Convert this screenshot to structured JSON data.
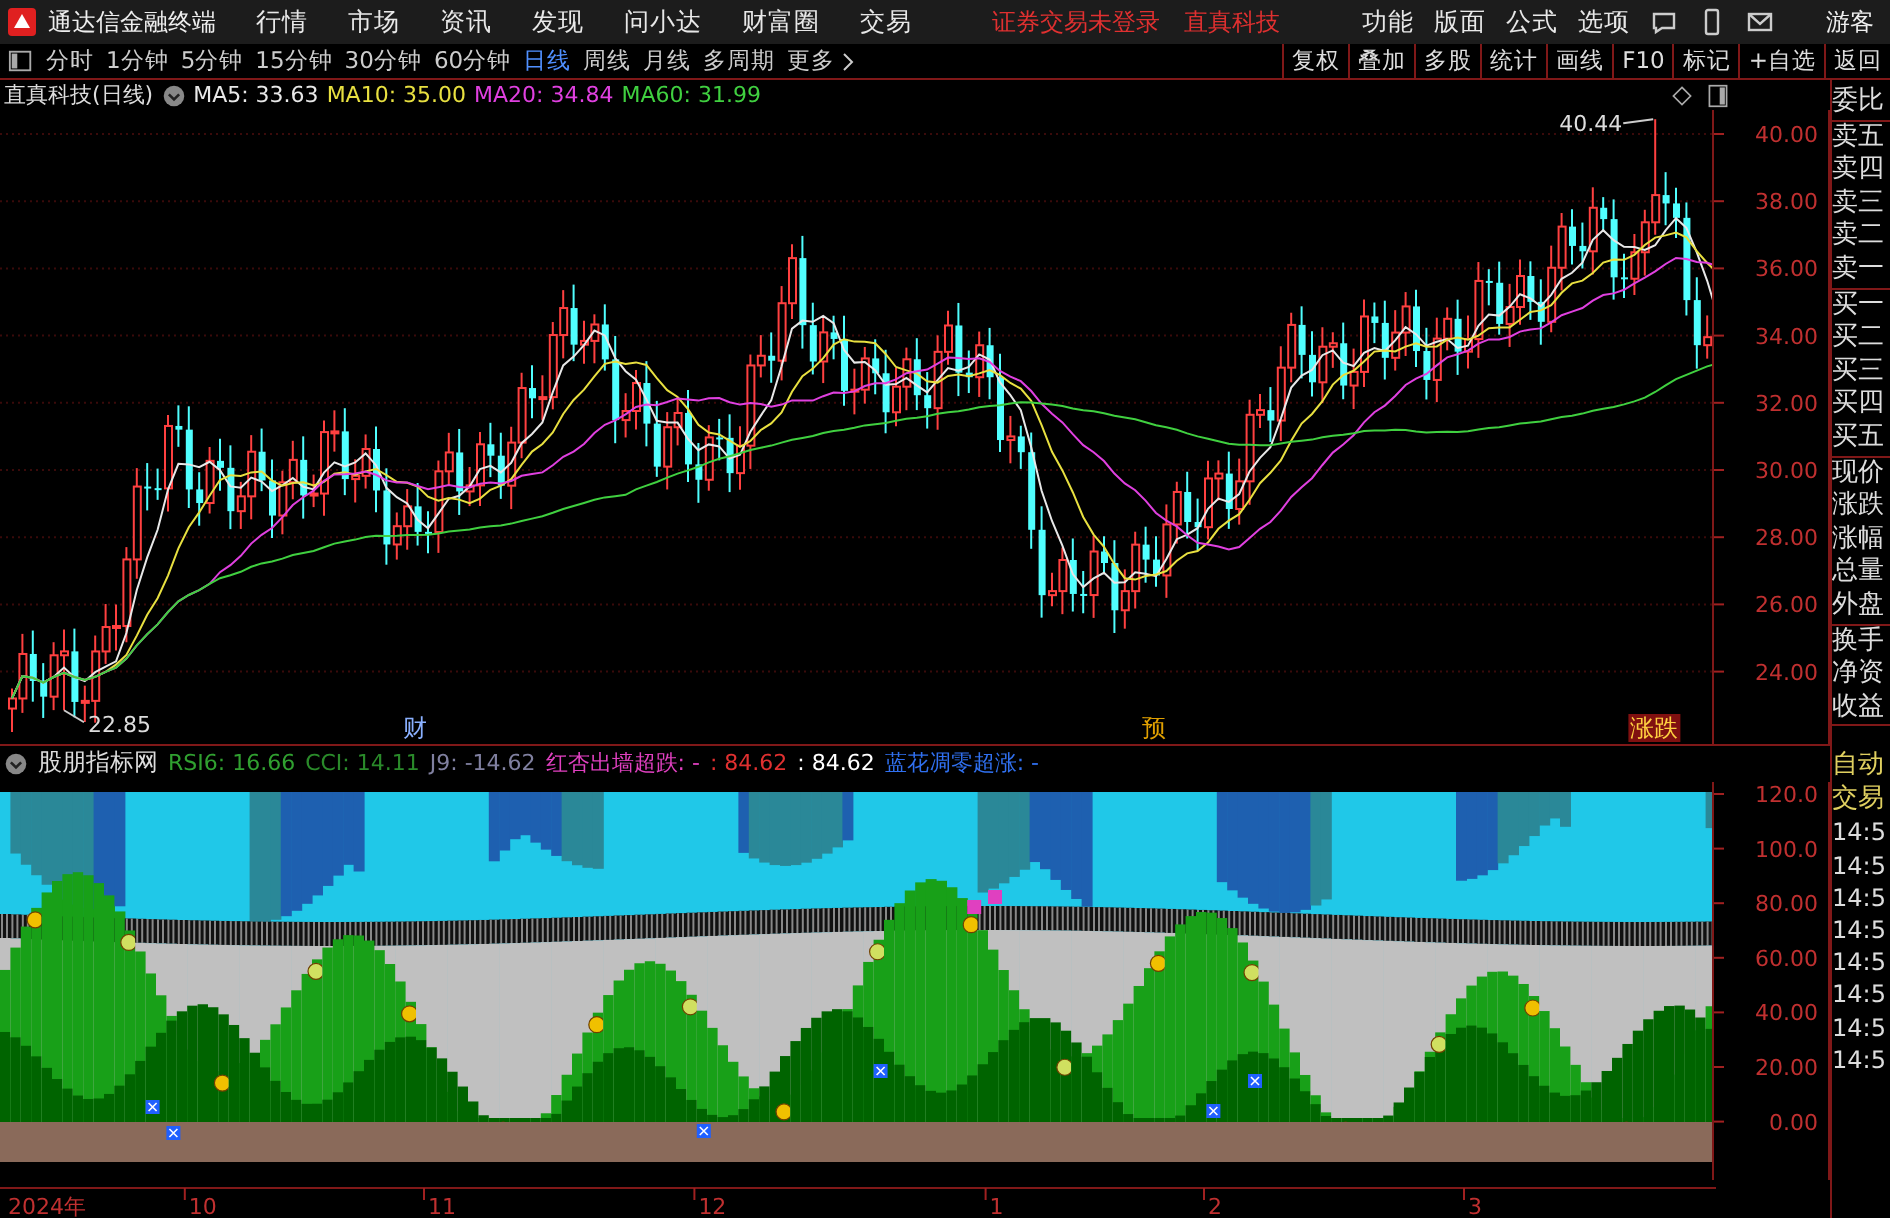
{
  "app": {
    "title": "通达信金融终端"
  },
  "menu": [
    "行情",
    "市场",
    "资讯",
    "发现",
    "问小达",
    "财富圈",
    "交易"
  ],
  "notice": {
    "login_status": "证券交易未登录",
    "broker": "直真科技"
  },
  "menu_right": [
    "功能",
    "版面",
    "公式",
    "选项"
  ],
  "user": "游客",
  "periods": [
    {
      "label": "分时",
      "selected": false
    },
    {
      "label": "1分钟",
      "selected": false
    },
    {
      "label": "5分钟",
      "selected": false
    },
    {
      "label": "15分钟",
      "selected": false
    },
    {
      "label": "30分钟",
      "selected": false
    },
    {
      "label": "60分钟",
      "selected": false
    },
    {
      "label": "日线",
      "selected": true
    },
    {
      "label": "周线",
      "selected": false
    },
    {
      "label": "月线",
      "selected": false
    },
    {
      "label": "多周期",
      "selected": false
    }
  ],
  "more": "更多",
  "tools": [
    "复权",
    "叠加",
    "多股",
    "统计",
    "画线",
    "F10",
    "标记",
    "+自选",
    "返回"
  ],
  "chart": {
    "title": "直真科技(日线)",
    "ma": [
      {
        "label": "MA5: 33.63",
        "color": "#e8e8e8"
      },
      {
        "label": "MA10: 35.00",
        "color": "#e8e040"
      },
      {
        "label": "MA20: 34.84",
        "color": "#e040e0"
      },
      {
        "label": "MA60: 31.99",
        "color": "#40d040"
      }
    ],
    "high_label": "40.44",
    "low_label": "22.85",
    "price_ticks": [
      "40.00",
      "38.00",
      "36.00",
      "34.00",
      "32.00",
      "30.00",
      "28.00",
      "26.00",
      "24.00"
    ],
    "events": [
      {
        "label": "财",
        "kind": "finance"
      },
      {
        "label": "预",
        "kind": "forecast"
      },
      {
        "label": "涨跌",
        "kind": "limit"
      }
    ]
  },
  "indicator": {
    "name": "股朋指标网",
    "values": [
      {
        "text": "RSI6: 16.66",
        "color": "#30a030"
      },
      {
        "text": "CCI: 14.11",
        "color": "#2a8a2a"
      },
      {
        "text": "J9: -14.62",
        "color": "#8080a0"
      },
      {
        "text": "红杏出墙超跌: -",
        "color": "#e040c0"
      },
      {
        "text": ": 84.62",
        "color": "#e03030"
      },
      {
        "text": ": 84.62",
        "color": "#ffffff"
      },
      {
        "text": "蓝花凋零超涨: -",
        "color": "#3070f0"
      }
    ],
    "ticks": [
      "120.0",
      "100.0",
      "80.00",
      "60.00",
      "40.00",
      "20.00",
      "0.00"
    ]
  },
  "date_axis": [
    "2024年",
    "10",
    "11",
    "12",
    "1",
    "2",
    "3"
  ],
  "quote_panel": [
    [
      "委比"
    ],
    [
      "卖五",
      "卖四",
      "卖三",
      "卖二",
      "卖一"
    ],
    [
      "买一",
      "买二",
      "买三",
      "买四",
      "买五"
    ],
    [
      "现价",
      "涨跌",
      "涨幅",
      "总量",
      "外盘"
    ],
    [
      "换手",
      "净资",
      "收益"
    ]
  ],
  "trade_panel": {
    "title": [
      "自动",
      "交易"
    ],
    "times": [
      "14:5",
      "14:5",
      "14:5",
      "14:5",
      "14:5",
      "14:5",
      "14:5",
      "14:5"
    ]
  }
}
